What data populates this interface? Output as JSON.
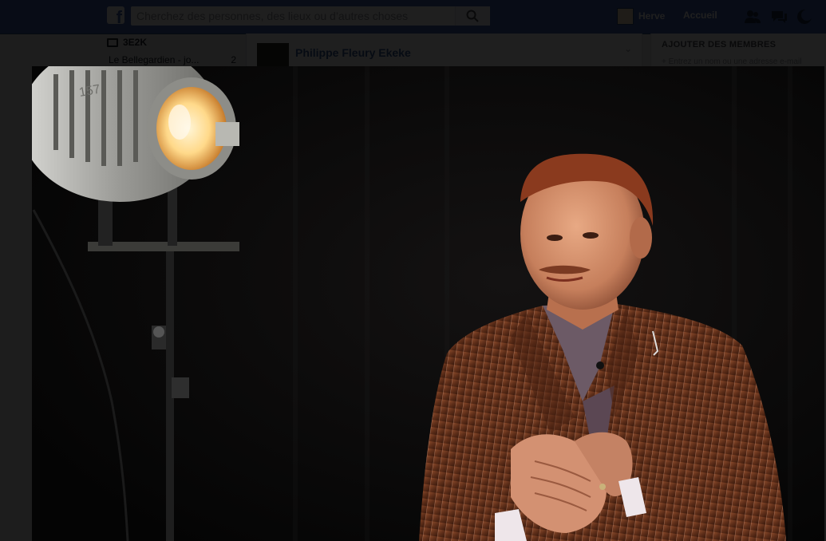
{
  "header": {
    "search_placeholder": "Cherchez des personnes, des lieux ou d’autres choses",
    "profile_name": "Herve",
    "home_label": "Accueil"
  },
  "icons": {
    "logo": "facebook-logo-icon",
    "search": "search-icon",
    "friends": "friends-icon",
    "messages": "messages-icon",
    "notifications": "globe-icon"
  },
  "left_column": {
    "group_name": "3E2K",
    "subitem_label": "Le Bellegardien - jo...",
    "subitem_count": "2"
  },
  "post": {
    "author": "Philippe Fleury Ekeke"
  },
  "right_column": {
    "heading": "AJOUTER DES MEMBRES",
    "input_hint": "+ Entrez un nom ou une adresse e-mail"
  },
  "colors": {
    "brand_blue": "#4267b2",
    "overlay": "rgba(0,0,0,0.88)",
    "video_bg": "#050505"
  }
}
